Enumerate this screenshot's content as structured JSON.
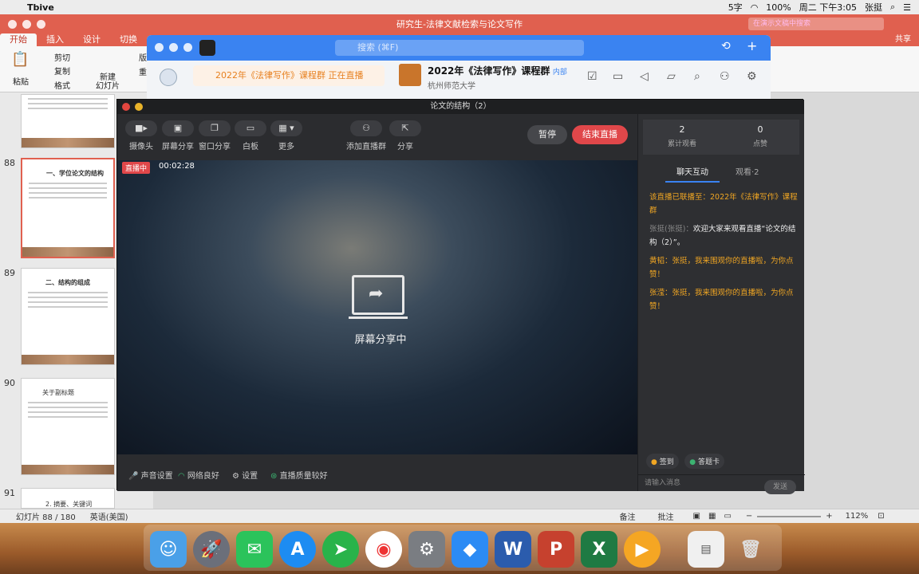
{
  "menubar": {
    "app_name": "Tbive",
    "ime": "5字",
    "battery": "100%",
    "clock": "周二 下午3:05",
    "user": "张挺"
  },
  "ppt": {
    "doc_title": "研究生-法律文献检索与论文写作",
    "search_placeholder": "在演示文稿中搜索",
    "tabs": [
      "开始",
      "插入",
      "设计",
      "切换"
    ],
    "share": "共享",
    "ribbon": {
      "paste": "粘贴",
      "cut": "剪切",
      "copy": "复制",
      "format": "格式",
      "new_slide": "新建\n幻灯片",
      "layout": "版",
      "reset": "重"
    },
    "slides": [
      {
        "no": "88",
        "title": "一、学位论文的结构"
      },
      {
        "no": "89",
        "title": "二、结构的组成"
      },
      {
        "no": "90",
        "title": "关于副标题"
      },
      {
        "no": "91",
        "title": "2. 摘要、关键词"
      }
    ],
    "status": {
      "slide_info": "幻灯片 88 / 180",
      "language": "英语(美国)",
      "notes": "备注",
      "comments": "批注",
      "zoom": "112%"
    }
  },
  "dingtalk": {
    "search_placeholder": "搜索 (⌘F)",
    "banner": "2022年《法律写作》课程群 正在直播",
    "group_name": "2022年《法律写作》课程群",
    "group_tag": "内部",
    "org": "杭州师范大学"
  },
  "live": {
    "title": "论文的结构（2）",
    "tools": [
      {
        "label": "摄像头",
        "icon": "camera-icon"
      },
      {
        "label": "屏幕分享",
        "icon": "screen-share-icon"
      },
      {
        "label": "窗口分享",
        "icon": "window-share-icon"
      },
      {
        "label": "白板",
        "icon": "whiteboard-icon"
      },
      {
        "label": "更多",
        "icon": "more-icon"
      },
      {
        "label": "添加直播群",
        "icon": "add-group-icon"
      },
      {
        "label": "分享",
        "icon": "share-icon"
      }
    ],
    "pause": "暂停",
    "end": "结束直播",
    "badge": "直播中",
    "timer": "00:02:28",
    "sharing": "屏幕分享中",
    "bottom": {
      "sound": "声音设置",
      "network": "网络良好",
      "settings": "设置",
      "quality": "直播质量较好"
    },
    "stats": {
      "views": "2",
      "views_label": "累计观看",
      "likes": "0",
      "likes_label": "点赞"
    },
    "side_tabs": {
      "chat": "聊天互动",
      "viewers": "观看·2"
    },
    "messages": [
      {
        "type": "sys",
        "text": "该直播已联播至：2022年《法律写作》课程群"
      },
      {
        "type": "user",
        "who": "张挺(张挺)：",
        "text": "欢迎大家来观看直播“论文的结构（2）”。"
      },
      {
        "type": "gold",
        "text": "黄韬：张挺，我来围观你的直播啦，为你点赞！"
      },
      {
        "type": "gold",
        "text": "张滢：张挺，我来围观你的直播啦，为你点赞！"
      }
    ],
    "actions": {
      "signin": "签到",
      "quiz": "答题卡"
    },
    "input_placeholder": "请输入消息",
    "send": "发送"
  }
}
